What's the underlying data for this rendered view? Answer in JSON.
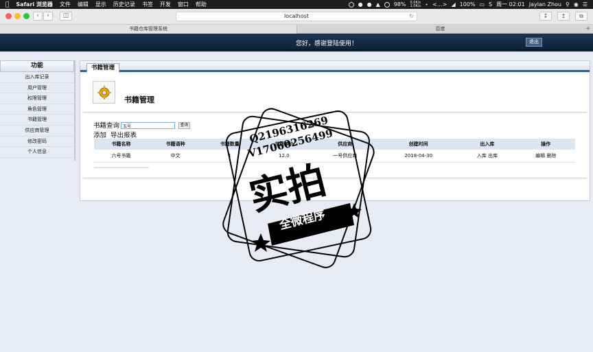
{
  "menubar": {
    "app_name": "Safari 浏览器",
    "menus": [
      "文件",
      "编辑",
      "显示",
      "历史记录",
      "书签",
      "开发",
      "窗口",
      "帮助"
    ],
    "battery": "98%",
    "net_up": "0.0K/s",
    "net_down": "1.0K/s",
    "volume": "100%",
    "clock": "周一 02:01",
    "user": "Jaylan Zhou"
  },
  "browser": {
    "url": "localhost",
    "tabs": [
      "书籍仓库管理系统",
      "百度"
    ]
  },
  "header": {
    "welcome": "您好，感谢登陆使用！",
    "logout": "退出"
  },
  "sidebar": {
    "title": "功能",
    "items": [
      "出入库记录",
      "用户管理",
      "权限管理",
      "角色管理",
      "书籍管理",
      "供应商管理",
      "修改密码",
      "个人信息"
    ]
  },
  "main": {
    "tab": "书籍管理",
    "title": "书籍管理",
    "query_label": "书籍查询",
    "query_value": "五号",
    "query_button": "查询",
    "add_link": "添加",
    "export_link": "导出报表",
    "table": {
      "headers": [
        "书籍名称",
        "书籍语种",
        "书籍数量",
        "书籍单价",
        "供应商",
        "创建时间",
        "出入库",
        "操作"
      ],
      "rows": [
        {
          "name": "六号书籍",
          "language": "中文",
          "quantity": "1",
          "price": "12.0",
          "supplier": "一号供应商",
          "created": "2018-04-30",
          "stock_in": "入库",
          "stock_out": "出库",
          "edit": "编辑",
          "delete": "删除"
        }
      ]
    }
  },
  "watermark": {
    "qq": "Q2196316269",
    "wechat": "V17060256499",
    "big": "实拍",
    "banner": "全微程序"
  }
}
